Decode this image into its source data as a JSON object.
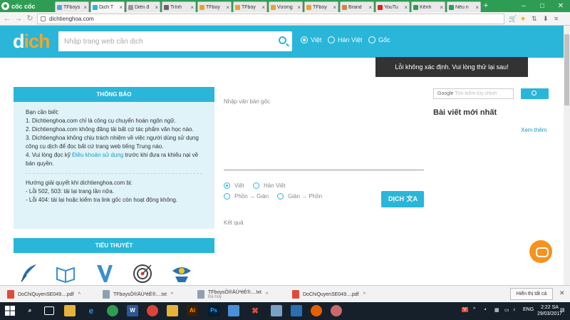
{
  "browser": {
    "brand": "cốc cốc",
    "tabs": [
      {
        "label": "TFboys",
        "color": "#5aa0e0"
      },
      {
        "label": "Dịch T",
        "color": "#29b6d9",
        "active": true
      },
      {
        "label": "Diễn đ",
        "color": "#999999"
      },
      {
        "label": "Trình",
        "color": "#666666"
      },
      {
        "label": "TFboy",
        "color": "#e8a32c"
      },
      {
        "label": "TFboy",
        "color": "#e8a32c"
      },
      {
        "label": "Vương",
        "color": "#e8a32c"
      },
      {
        "label": "TFboy",
        "color": "#e8a32c"
      },
      {
        "label": "Brand",
        "color": "#cc8844"
      },
      {
        "label": "YouTu",
        "color": "#e62117"
      },
      {
        "label": "Kênh",
        "color": "#2e9d53"
      },
      {
        "label": "Nếu n",
        "color": "#2e9d53"
      }
    ],
    "url": "dichtienghoa.com"
  },
  "site": {
    "logo_main": "d",
    "logo_accent": "ich",
    "search_placeholder": "Nhập trang web cần dịch",
    "modes": [
      "Việt",
      "Hán Việt",
      "Gốc"
    ]
  },
  "toast": "Lỗi không xác định. Vui lòng thử lại sau!",
  "notice": {
    "heading": "THÔNG BÁO",
    "intro": "Bạn cần biết:",
    "items": [
      "1. Dichtienghoa.com chỉ là công cụ chuyển hoán ngôn ngữ.",
      "2. Dichtienghoa.com không đăng tải bất cứ tác phẩm văn học nào.",
      "3. Dichtienghoa không chịu trách nhiệm về việc người dùng sử dụng công cụ dịch để đọc bất cứ trang web tiếng Trung nào."
    ],
    "item4_pre": "4. Vui lòng đọc kỹ ",
    "item4_link": "Điều khoản sử dụng",
    "item4_post": " trước khi đưa ra khiếu nại về bản quyền.",
    "fix_heading": "Hướng giải quyết khi dichtienghoa.com bị:",
    "fixes": [
      "- Lỗi 502, 503: tải lại trang lần nữa.",
      "- Lỗi 404: tải lại hoặc kiểm tra link gốc còn hoạt động không."
    ]
  },
  "novels": {
    "heading": "TIỂU THUYẾT"
  },
  "translator": {
    "input_label": "Nhập văn bản gốc",
    "options_row1": [
      "Việt",
      "Hán Việt"
    ],
    "options_row2": [
      "Phồn → Giản",
      "Giản → Phồn"
    ],
    "button": "DỊCH",
    "button_icon": "文A",
    "result_label": "Kết quả"
  },
  "sidebar": {
    "google_label": "Google",
    "search_placeholder": "Tìm kiếm tùy chỉnh",
    "newest_title": "Bài viết mới nhất",
    "more_link": "Xem thêm"
  },
  "downloads": {
    "items": [
      {
        "name": "DoChiQuyenSE049....pdf",
        "sub": "",
        "color": "#e04a3a"
      },
      {
        "name": "TFboysÖ®ÄÚ²èÉ®....txt",
        "sub": "",
        "color": "#8fa0b0"
      },
      {
        "name": "TFboysÖ®ÄÚ²èÉ®....txt",
        "sub": "Đã hủy",
        "color": "#8fa0b0"
      },
      {
        "name": "DoChiQuyenSE049....pdf",
        "sub": "",
        "color": "#e04a3a"
      }
    ],
    "show_all": "Hiển thị tất cả"
  },
  "taskbar": {
    "lang": "ENG",
    "time": "2:22 SA",
    "date": "29/03/2017"
  }
}
